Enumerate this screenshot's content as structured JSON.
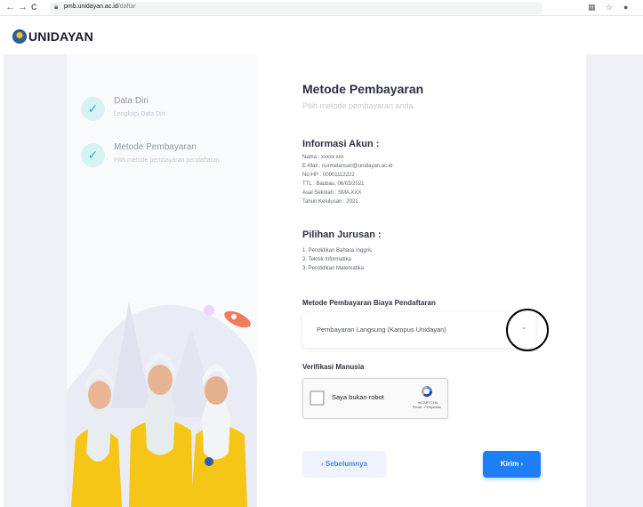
{
  "browser": {
    "back_icon": "←",
    "forward_icon": "→",
    "reload_icon": "C",
    "url_host": "pmb.unidayan.ac.id",
    "url_path": "/daftar"
  },
  "header": {
    "logo_text": "UNIDAYAN"
  },
  "steps": [
    {
      "title": "Data Diri",
      "desc": "Lengkapi Data Diri"
    },
    {
      "title": "Metode Pembayaran",
      "desc": "Pilih metode pembayaran pendaftaran"
    }
  ],
  "main": {
    "title": "Metode Pembayaran",
    "subtitle": "Pilih metode pembayaran anda.",
    "account": {
      "heading": "Informasi Akun :",
      "lines": [
        "Nama : xxxxx xxx",
        "E-Mail : nurmelansari@unidayan.ac.id",
        "No-HP : 00001112222",
        "TTL : Baubau, 06/03/2021",
        "Asal Sekolah : SMA XXX",
        "Tahun Kelulusan : 2021"
      ]
    },
    "majors": {
      "heading": "Pilihan Jurusan :",
      "items": [
        "1. Pendidikan Bahasa Inggris",
        "2. Teknik Informatika",
        "3. Pendidikan Matematika"
      ]
    },
    "payment": {
      "label": "Metode Pembayaran Biaya Pendaftaran",
      "selected": "Pembayaran Langsung (Kampus Unidayan)"
    },
    "verification": {
      "label": "Verifikasi Manusia",
      "checkbox_label": "Saya bukan robot",
      "brand": "reCAPTCHA",
      "links": "Privasi - Persyaratan"
    },
    "buttons": {
      "prev": "‹  Sebelumnya",
      "next": "Kirim  ›"
    }
  },
  "colors": {
    "accent": "#1e7ff5",
    "step_check": "#23b4be",
    "jacket": "#f5c518",
    "background": "#eef0f6"
  }
}
